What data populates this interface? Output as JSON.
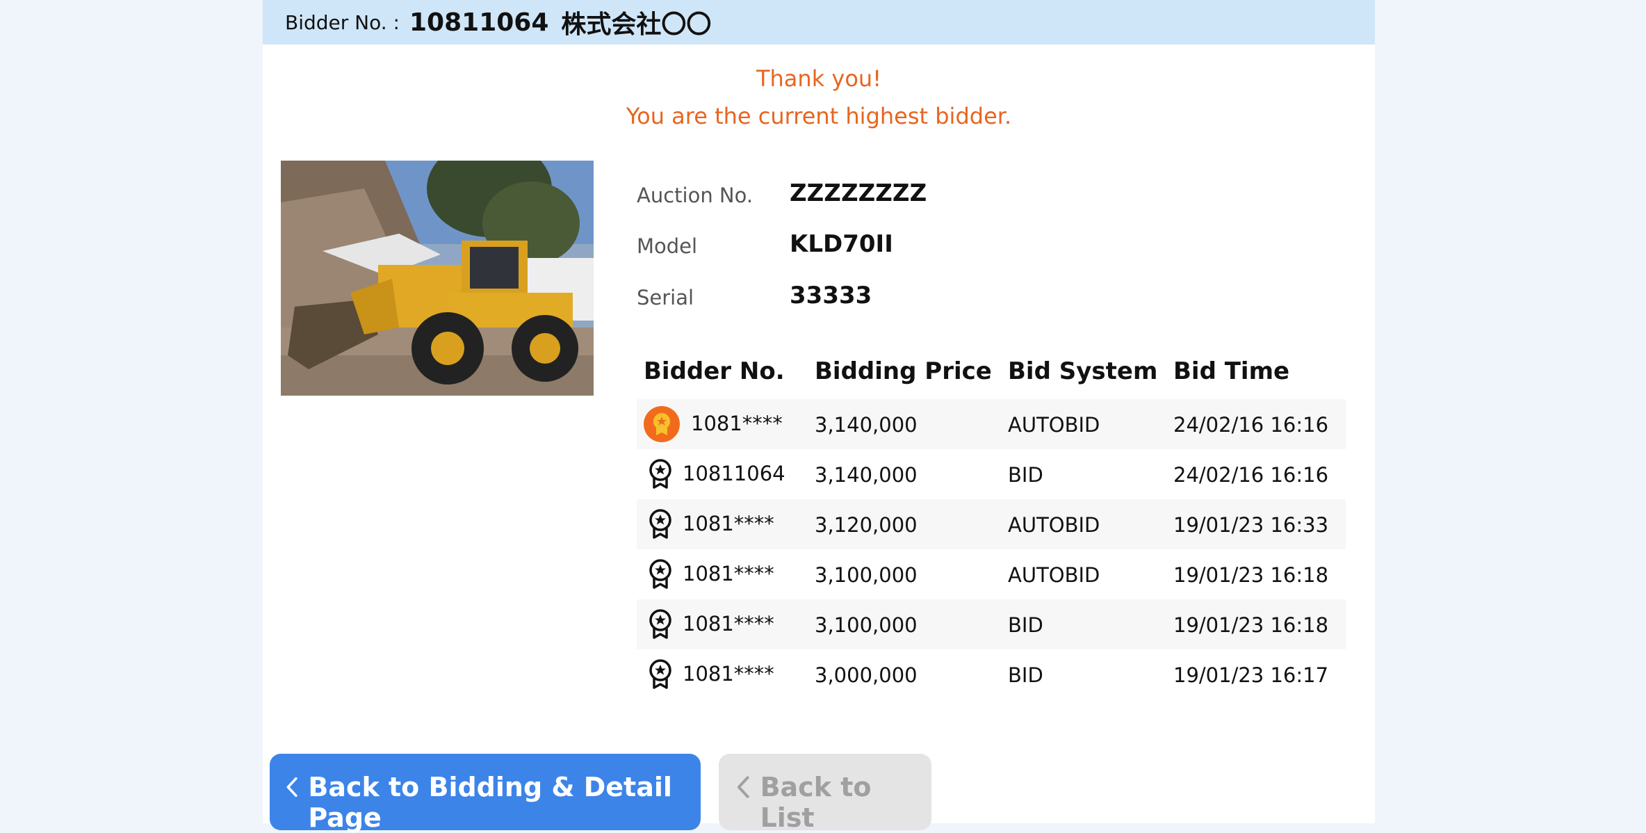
{
  "header": {
    "bidder_label": "Bidder No. :",
    "bidder_no": "10811064",
    "company": "株式会社〇〇"
  },
  "message": {
    "line1": "Thank you!",
    "line2": "You are the current highest bidder."
  },
  "item": {
    "auction_label": "Auction No.",
    "auction_value": "ZZZZZZZZ",
    "model_label": "Model",
    "model_value": "KLD70II",
    "serial_label": "Serial",
    "serial_value": "33333"
  },
  "bids": {
    "columns": [
      "Bidder No.",
      "Bidding Price",
      "Bid System",
      "Bid Time"
    ],
    "rows": [
      {
        "bidder": "1081****",
        "price": "3,140,000",
        "system": "AUTOBID",
        "time": "24/02/16 16:16",
        "top": true
      },
      {
        "bidder": "10811064",
        "price": "3,140,000",
        "system": "BID",
        "time": "24/02/16 16:16",
        "top": false
      },
      {
        "bidder": "1081****",
        "price": "3,120,000",
        "system": "AUTOBID",
        "time": "19/01/23 16:33",
        "top": false
      },
      {
        "bidder": "1081****",
        "price": "3,100,000",
        "system": "AUTOBID",
        "time": "19/01/23 16:18",
        "top": false
      },
      {
        "bidder": "1081****",
        "price": "3,100,000",
        "system": "BID",
        "time": "19/01/23 16:18",
        "top": false
      },
      {
        "bidder": "1081****",
        "price": "3,000,000",
        "system": "BID",
        "time": "19/01/23 16:17",
        "top": false
      }
    ]
  },
  "buttons": {
    "back_detail": "Back to Bidding & Detail Page",
    "back_list": "Back to List"
  },
  "colors": {
    "accent": "#e8651f",
    "primary": "#3d84e8",
    "header_bg": "#cfe6f8"
  }
}
